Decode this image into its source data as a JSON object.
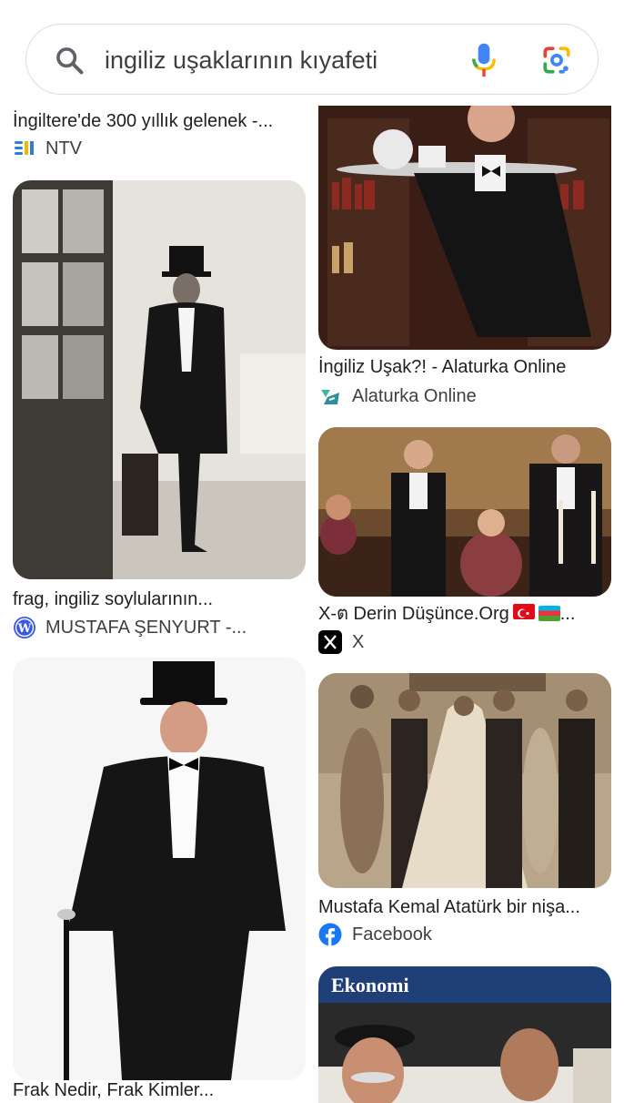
{
  "search": {
    "query": "ingiliz uşaklarının kıyafeti",
    "search_icon": "search-icon",
    "mic_icon": "microphone-icon",
    "lens_icon": "google-lens-icon"
  },
  "results": [
    {
      "title": "İngiltere'de 300 yıllık gelenek -...",
      "source": "NTV",
      "source_icon": "ntv-logo-icon"
    },
    {
      "title": "İngiliz Uşak?! - Alaturka Online",
      "source": "Alaturka Online",
      "source_icon": "alaturka-logo-icon"
    },
    {
      "title": "frag, ingiliz soylularının...",
      "source": "MUSTAFA ŞENYURT -...",
      "source_icon": "wordpress-icon"
    },
    {
      "title": "X-ต Derin Düşünce.Org",
      "title_suffix": "...",
      "source": "X",
      "source_icon": "x-logo-icon"
    },
    {
      "title": "Mustafa Kemal Atatürk bir nişa...",
      "source": "Facebook",
      "source_icon": "facebook-icon"
    },
    {
      "title": "Frak Nedir, Frak Kimler...",
      "source": "",
      "source_icon": ""
    },
    {
      "title": "",
      "image_text": "Ekonomi",
      "source": "",
      "source_icon": ""
    }
  ],
  "colors": {
    "accent_blue": "#1a73e8",
    "facebook_blue": "#1877f2",
    "wordpress_blue": "#3858e9",
    "text": "#202124"
  }
}
